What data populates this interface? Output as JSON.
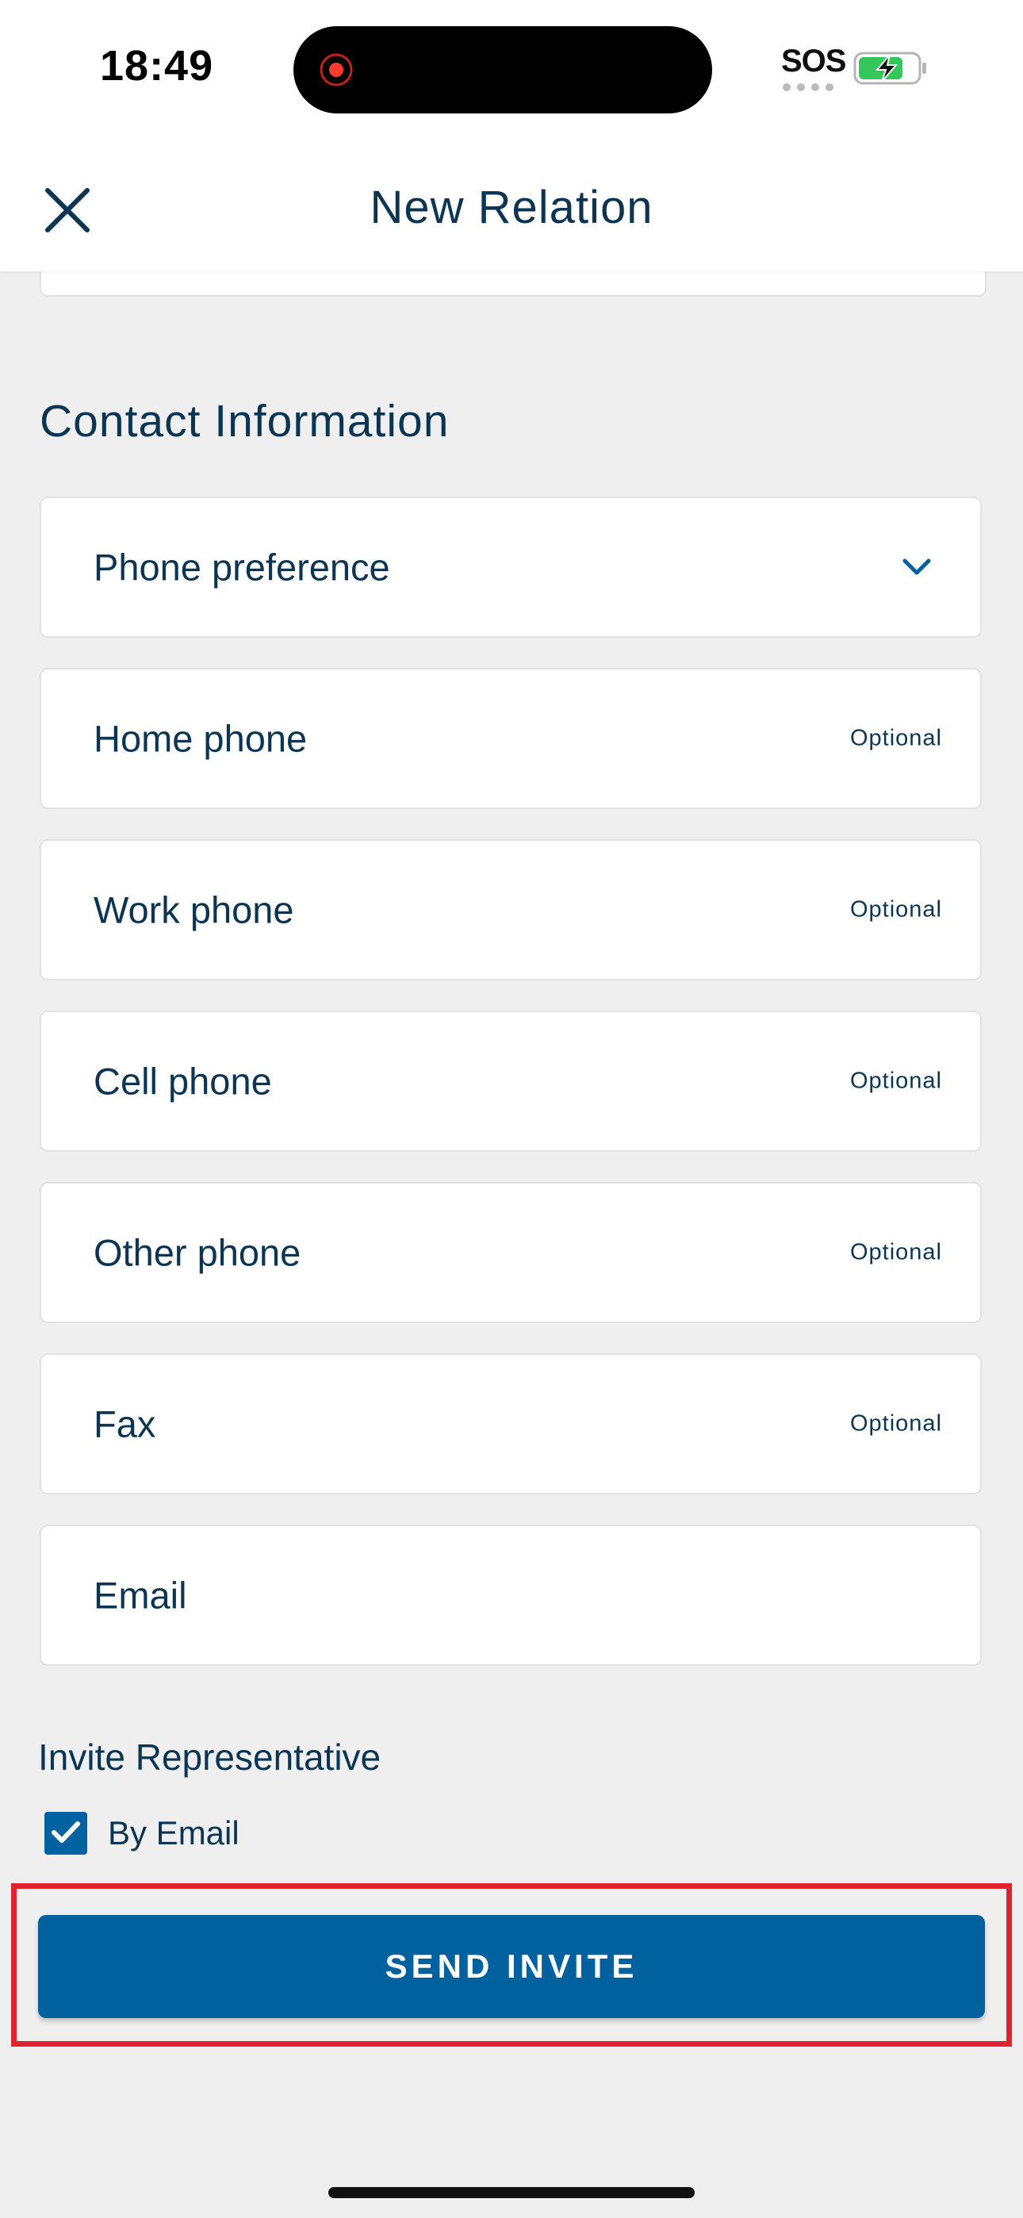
{
  "status_bar": {
    "time": "18:49",
    "carrier": "SOS",
    "battery_color": "#34c759"
  },
  "nav": {
    "title": "New Relation",
    "close_icon": "close-icon"
  },
  "section": {
    "heading": "Contact Information"
  },
  "fields": {
    "phone_preference": {
      "label": "Phone preference",
      "icon": "chevron-down-icon"
    },
    "home_phone": {
      "label": "Home phone",
      "optional": "Optional"
    },
    "work_phone": {
      "label": "Work phone",
      "optional": "Optional"
    },
    "cell_phone": {
      "label": "Cell phone",
      "optional": "Optional"
    },
    "other_phone": {
      "label": "Other phone",
      "optional": "Optional"
    },
    "fax": {
      "label": "Fax",
      "optional": "Optional"
    },
    "email": {
      "label": "Email"
    }
  },
  "invite": {
    "label": "Invite Representative",
    "by_email_label": "By Email",
    "by_email_checked": true
  },
  "send_button": {
    "label": "SEND INVITE"
  },
  "colors": {
    "primary": "#00619f",
    "text": "#0b3553",
    "background": "#efefef",
    "highlight": "#e0242f"
  }
}
